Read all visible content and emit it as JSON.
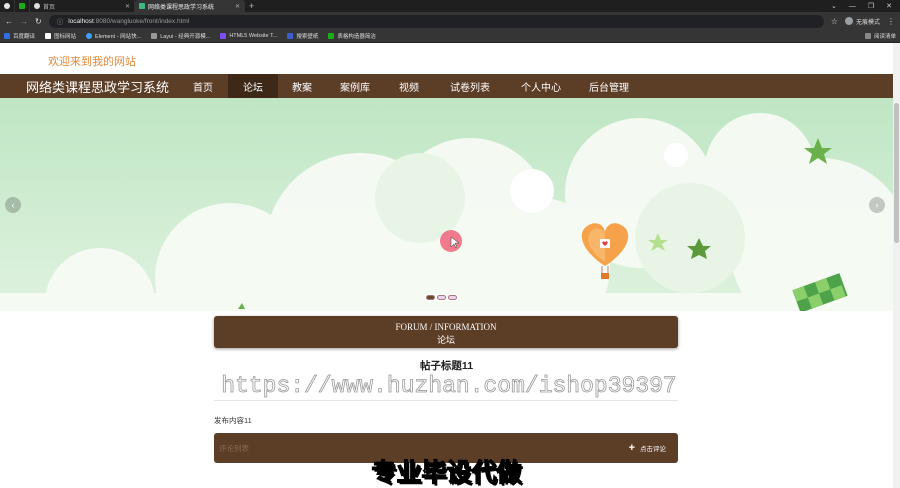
{
  "browser": {
    "tabs": [
      {
        "label": ""
      },
      {
        "label": "首页"
      },
      {
        "label": "网络类课程思政学习系统",
        "active": true
      }
    ],
    "new_tab": "+",
    "url_host": "localhost",
    "url_path": ":8080/wangluoke/front/index.html",
    "profile_label": "无痕模式",
    "bookmarks": [
      "百度翻译",
      "图标网站",
      "Element - 网站快...",
      "Layui - 经典开源模...",
      "HTML5 Website T...",
      "搜索壁纸",
      "表格构造器简洁"
    ],
    "reading_list": "阅读清单"
  },
  "header": {
    "welcome": "欢迎来到我的网站",
    "site_title": "网络类课程思政学习系统",
    "nav": [
      "首页",
      "论坛",
      "教案",
      "案例库",
      "视频",
      "试卷列表",
      "个人中心",
      "后台管理"
    ],
    "active_nav": "论坛"
  },
  "carousel": {
    "prev": "‹",
    "next": "›",
    "slide_count": 3,
    "active_index": 0
  },
  "forum": {
    "section_en": "FORUM / INFORMATION",
    "section_cn": "论坛",
    "post_title": "帖子标题11",
    "post_content": "发布内容11",
    "comment_list_label": "评论列表",
    "comment_button_icon": "+",
    "comment_button_label": "点击评论"
  },
  "overlays": {
    "watermark": "https://www.huzhan.com/ishop39397",
    "caption": "专业毕设代做"
  },
  "colors": {
    "nav_bg": "#5c3d26",
    "nav_active": "#3e2818",
    "welcome": "#e08a3c",
    "banner_bg": "#c7e8c9"
  }
}
